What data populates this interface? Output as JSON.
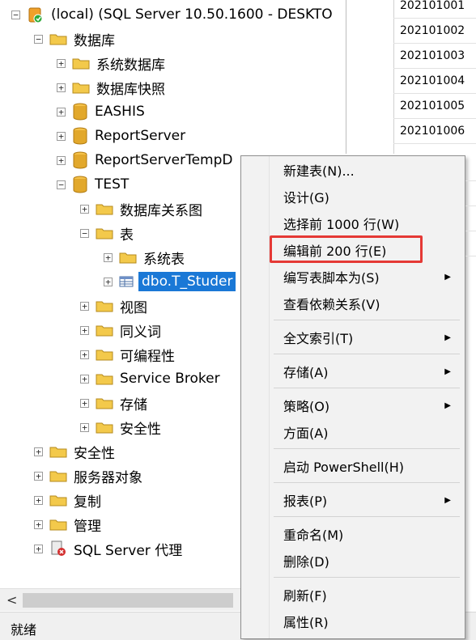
{
  "tree": {
    "server": "(local) (SQL Server 10.50.1600 - DESKTO",
    "databases": "数据库",
    "system_databases": "系统数据库",
    "db_snapshots": "数据库快照",
    "eashis": "EASHIS",
    "reportserver": "ReportServer",
    "reportservertemp": "ReportServerTempD",
    "test": "TEST",
    "db_diagrams": "数据库关系图",
    "tables": "表",
    "system_tables": "系统表",
    "selected_table": "dbo.T_Studer",
    "views": "视图",
    "synonyms": "同义词",
    "programmability": "可编程性",
    "service_broker": "Service Broker",
    "storage": "存储",
    "db_security": "安全性",
    "security": "安全性",
    "server_objects": "服务器对象",
    "replication": "复制",
    "management": "管理",
    "sql_agent": "SQL Server 代理"
  },
  "grid": {
    "rows": [
      "202101001",
      "202101002",
      "202101003",
      "202101004",
      "202101005",
      "202101006"
    ]
  },
  "status": {
    "text": "就绪"
  },
  "context_menu": {
    "items": [
      {
        "label": "新建表(N)...",
        "submenu": false
      },
      {
        "label": "设计(G)",
        "submenu": false
      },
      {
        "label": "选择前 1000 行(W)",
        "submenu": false
      },
      {
        "label": "编辑前 200 行(E)",
        "submenu": false
      },
      {
        "label": "编写表脚本为(S)",
        "submenu": true
      },
      {
        "label": "查看依赖关系(V)",
        "submenu": false
      },
      {
        "label": "全文索引(T)",
        "submenu": true
      },
      {
        "label": "存储(A)",
        "submenu": true
      },
      {
        "label": "策略(O)",
        "submenu": true
      },
      {
        "label": "方面(A)",
        "submenu": false
      },
      {
        "label": "启动 PowerShell(H)",
        "submenu": false
      },
      {
        "label": "报表(P)",
        "submenu": true
      },
      {
        "label": "重命名(M)",
        "submenu": false
      },
      {
        "label": "删除(D)",
        "submenu": false
      },
      {
        "label": "刷新(F)",
        "submenu": false
      },
      {
        "label": "属性(R)",
        "submenu": false
      }
    ],
    "highlighted_item": "编辑前 200 行(E)",
    "submenu_arrow": "▶",
    "highlight_color": "#e53935"
  },
  "colors": {
    "selection": "#1a78d6",
    "folder": "#f3c94b",
    "database": "#e2a82c"
  }
}
